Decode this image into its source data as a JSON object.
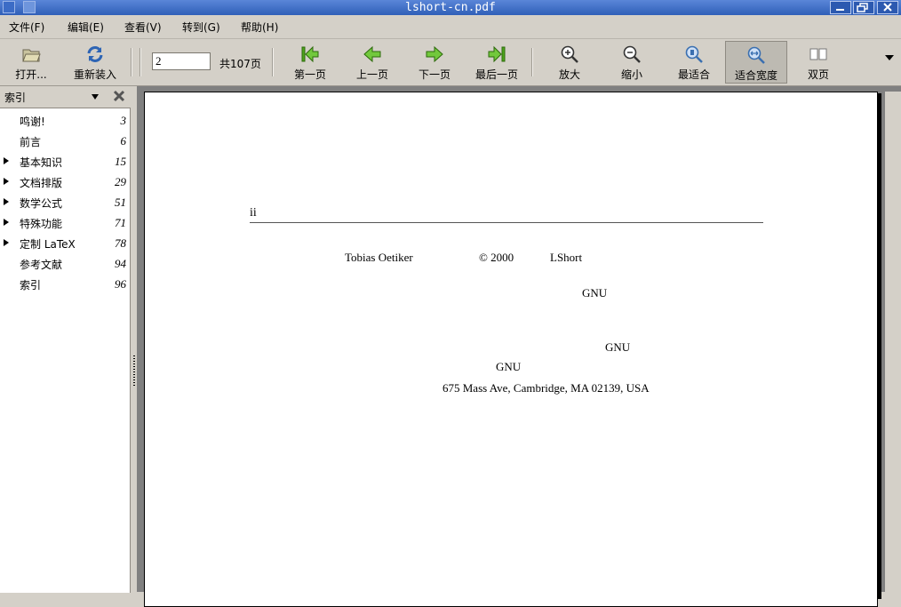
{
  "window": {
    "title": "lshort-cn.pdf"
  },
  "menubar": {
    "items": [
      "文件(F)",
      "编辑(E)",
      "查看(V)",
      "转到(G)",
      "帮助(H)"
    ]
  },
  "toolbar": {
    "open_label": "打开...",
    "reload_label": "重新装入",
    "page_input": "2",
    "page_count": "共107页",
    "first_label": "第一页",
    "prev_label": "上一页",
    "next_label": "下一页",
    "last_label": "最后一页",
    "zoom_in_label": "放大",
    "zoom_out_label": "缩小",
    "best_fit_label": "最适合",
    "fit_width_label": "适合宽度",
    "dual_page_label": "双页"
  },
  "sidebar": {
    "title": "索引",
    "items": [
      {
        "label": "鸣谢!",
        "page": "3"
      },
      {
        "label": "前言",
        "page": "6"
      },
      {
        "label": "基本知识",
        "page": "15"
      },
      {
        "label": "文档排版",
        "page": "29"
      },
      {
        "label": "数学公式",
        "page": "51"
      },
      {
        "label": "特殊功能",
        "page": "71"
      },
      {
        "label": "定制 LaTeX",
        "page": "78"
      },
      {
        "label": "参考文献",
        "page": "94"
      },
      {
        "label": "索引",
        "page": "96"
      }
    ]
  },
  "document": {
    "page_number": "ii",
    "author": "Tobias Oetiker",
    "copyright": "© 2000",
    "title": "LShort",
    "gnu1": "GNU",
    "gnu2": "GNU",
    "gnu3": "GNU",
    "address": "675 Mass Ave, Cambridge, MA 02139, USA"
  }
}
